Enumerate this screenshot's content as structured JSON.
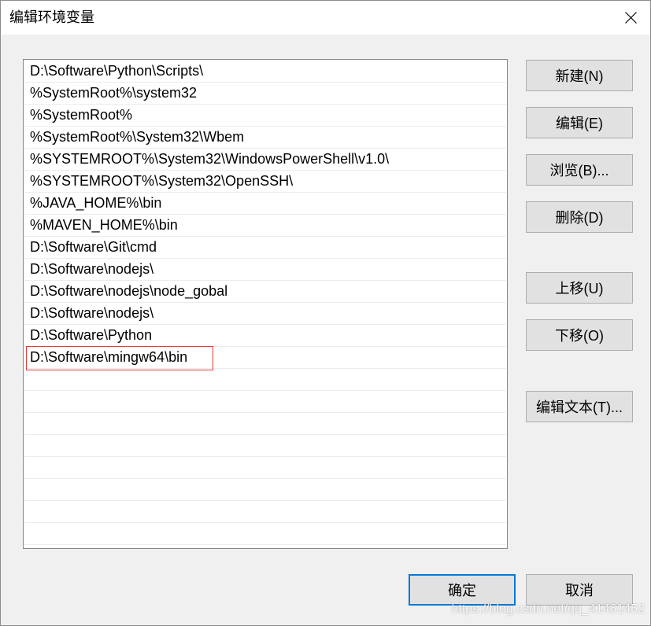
{
  "window": {
    "title": "编辑环境变量"
  },
  "icons": {
    "close": "close-icon"
  },
  "path_list": {
    "items": [
      "D:\\Software\\Python\\Scripts\\",
      "%SystemRoot%\\system32",
      "%SystemRoot%",
      "%SystemRoot%\\System32\\Wbem",
      "%SYSTEMROOT%\\System32\\WindowsPowerShell\\v1.0\\",
      "%SYSTEMROOT%\\System32\\OpenSSH\\",
      "%JAVA_HOME%\\bin",
      "%MAVEN_HOME%\\bin",
      "D:\\Software\\Git\\cmd",
      "D:\\Software\\nodejs\\",
      "D:\\Software\\nodejs\\node_gobal",
      "D:\\Software\\nodejs\\",
      "D:\\Software\\Python",
      "D:\\Software\\mingw64\\bin"
    ]
  },
  "side_buttons": {
    "new": "新建(N)",
    "edit": "编辑(E)",
    "browse": "浏览(B)...",
    "delete": "删除(D)",
    "move_up": "上移(U)",
    "move_down": "下移(O)",
    "edit_text": "编辑文本(T)..."
  },
  "footer": {
    "ok": "确定",
    "cancel": "取消"
  },
  "watermark": "https://blog.csdn.net/qq_41461452",
  "colors": {
    "accent": "#0078d7",
    "highlight_box": "#e53935",
    "window_bg": "#f0f0f0",
    "titlebar_bg": "#ffffff",
    "button_bg": "#e1e1e1",
    "button_border": "#adadad",
    "list_border": "#828790"
  }
}
